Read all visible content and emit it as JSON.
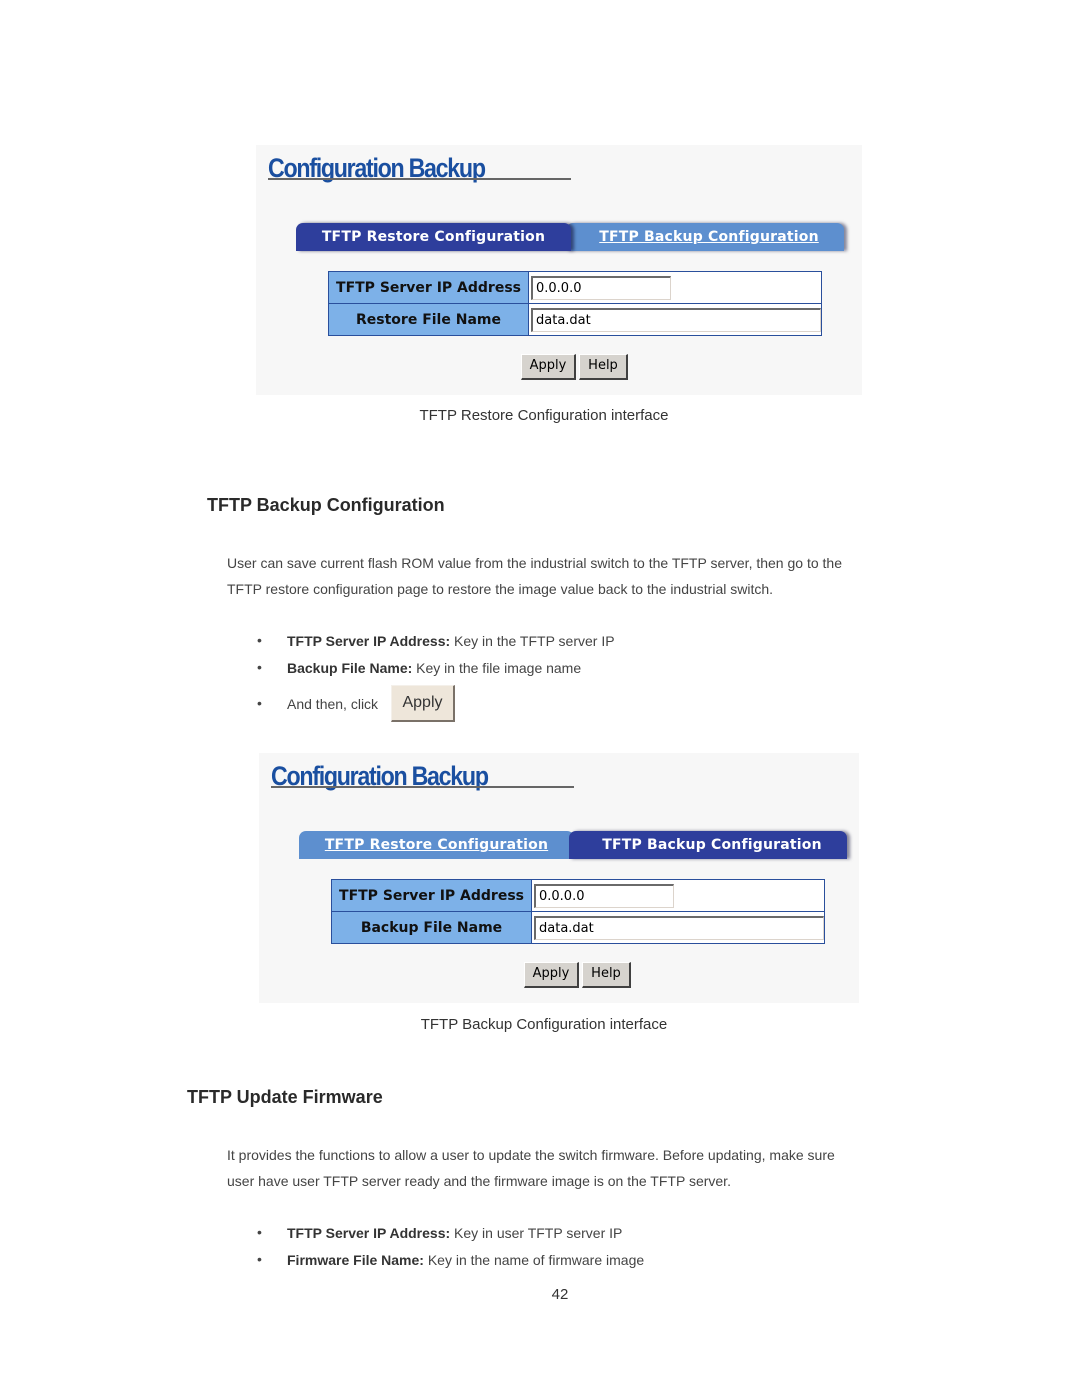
{
  "restore_panel": {
    "title": "Configuration Backup",
    "tabs": [
      {
        "label": "TFTP Restore Configuration",
        "active": true
      },
      {
        "label": "TFTP Backup Configuration",
        "active": false
      }
    ],
    "fields": [
      {
        "label": "TFTP Server IP Address",
        "value": "0.0.0.0"
      },
      {
        "label": "Restore File Name",
        "value": "data.dat"
      }
    ],
    "buttons": {
      "apply": "Apply",
      "help": "Help"
    },
    "caption": "TFTP Restore Configuration interface"
  },
  "backup_section": {
    "heading": "TFTP Backup Configuration",
    "paragraph_lines": [
      "User can save current flash ROM value from the industrial switch to the TFTP server, then go to the",
      "TFTP restore configuration page to restore the image value back to the industrial switch."
    ],
    "bullets": [
      {
        "term": "TFTP Server IP Address:",
        "text": " Key in the TFTP server IP"
      },
      {
        "term": "Backup File Name:",
        "text": " Key in the file image name"
      },
      {
        "term": "",
        "text": "And then, click"
      }
    ],
    "inline_button": "Apply",
    "bullet_glyph": "•"
  },
  "backup_panel": {
    "title": "Configuration Backup",
    "tabs": [
      {
        "label": "TFTP Restore Configuration",
        "active": false
      },
      {
        "label": "TFTP Backup Configuration",
        "active": true
      }
    ],
    "fields": [
      {
        "label": "TFTP Server IP Address",
        "value": "0.0.0.0"
      },
      {
        "label": "Backup File Name",
        "value": "data.dat"
      }
    ],
    "buttons": {
      "apply": "Apply",
      "help": "Help"
    },
    "caption": "TFTP Backup Configuration interface"
  },
  "firmware_section": {
    "heading": "TFTP Update Firmware",
    "paragraph_lines": [
      "It provides the functions to allow a user to update the switch firmware. Before updating, make sure",
      "user have user TFTP server ready and the firmware image is on the TFTP server."
    ],
    "bullets": [
      {
        "term": "TFTP Server IP Address:",
        "text": " Key in user TFTP server IP"
      },
      {
        "term": "Firmware File Name:",
        "text": " Key in the name of firmware image"
      }
    ]
  },
  "page_number": "42",
  "colors": {
    "tab_active": "#2e3e9c",
    "tab_inactive": "#5d8fcf",
    "label_cell": "#7db1e8",
    "title_blue": "#1a4fa0"
  }
}
